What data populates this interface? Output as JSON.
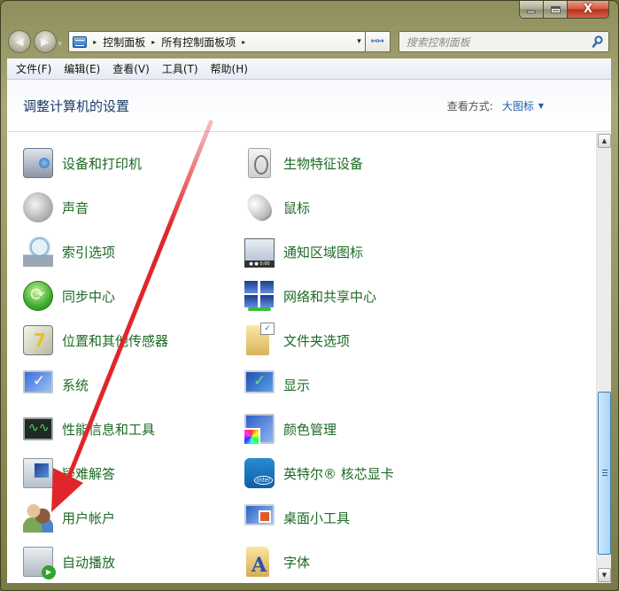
{
  "window": {
    "caption_buttons": {
      "minimize_icon": "minimize-icon",
      "maximize_icon": "maximize-icon",
      "close_icon": "close-icon",
      "close_glyph": "X"
    }
  },
  "navigation": {
    "back_glyph": "◀",
    "forward_glyph": "▶",
    "history_glyph": "▾",
    "breadcrumb": [
      "控制面板",
      "所有控制面板项"
    ],
    "breadcrumb_separator": "▸",
    "address_dropdown_glyph": "▾",
    "refresh_glyph": "↤↦",
    "search_placeholder": "搜索控制面板"
  },
  "menubar": {
    "items": [
      "文件(F)",
      "编辑(E)",
      "查看(V)",
      "工具(T)",
      "帮助(H)"
    ]
  },
  "header": {
    "title": "调整计算机的设置",
    "view_by_label": "查看方式:",
    "view_by_value": "大图标",
    "view_by_caret": "▼"
  },
  "items": {
    "left": [
      {
        "label": "设备和打印机",
        "icon": "printer-icon"
      },
      {
        "label": "声音",
        "icon": "speaker-icon"
      },
      {
        "label": "索引选项",
        "icon": "index-search-icon"
      },
      {
        "label": "同步中心",
        "icon": "sync-icon"
      },
      {
        "label": "位置和其他传感器",
        "icon": "location-sensor-icon"
      },
      {
        "label": "系统",
        "icon": "system-icon"
      },
      {
        "label": "性能信息和工具",
        "icon": "performance-icon"
      },
      {
        "label": "疑难解答",
        "icon": "troubleshoot-icon"
      },
      {
        "label": "用户帐户",
        "icon": "user-accounts-icon"
      },
      {
        "label": "自动播放",
        "icon": "autoplay-icon"
      }
    ],
    "right": [
      {
        "label": "生物特征设备",
        "icon": "fingerprint-icon"
      },
      {
        "label": "鼠标",
        "icon": "mouse-icon"
      },
      {
        "label": "通知区域图标",
        "icon": "notification-area-icon"
      },
      {
        "label": "网络和共享中心",
        "icon": "network-icon"
      },
      {
        "label": "文件夹选项",
        "icon": "folder-options-icon"
      },
      {
        "label": "显示",
        "icon": "display-icon"
      },
      {
        "label": "颜色管理",
        "icon": "color-management-icon"
      },
      {
        "label": "英特尔® 核芯显卡",
        "icon": "intel-graphics-icon"
      },
      {
        "label": "桌面小工具",
        "icon": "desktop-gadgets-icon"
      },
      {
        "label": "字体",
        "icon": "fonts-icon"
      }
    ]
  },
  "scrollbar": {
    "up_glyph": "▲",
    "down_glyph": "▼",
    "thumb_start_fraction": 0.58,
    "thumb_size_fraction": 0.39
  },
  "annotation": {
    "type": "red-arrow",
    "color": "#e0262b",
    "points_to": "用户帐户"
  }
}
